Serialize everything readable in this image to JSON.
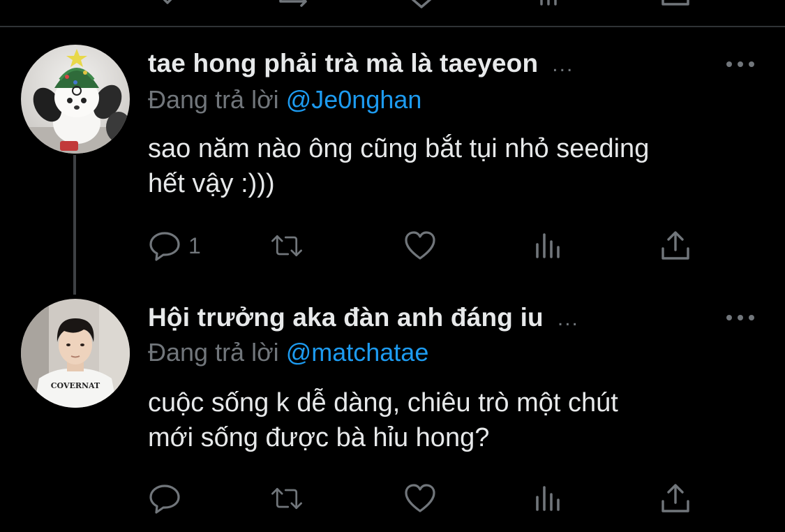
{
  "tweets": [
    {
      "display_name": "tae hong phải trà mà là taeyeon",
      "name_ellipsis": "...",
      "reply_prefix": "Đang trả lời",
      "reply_to": "@Je0nghan",
      "text_line1": "sao năm nào ông cũng bắt tụi nhỏ seeding",
      "text_line2": "hết vậy :)))",
      "reply_count": "1"
    },
    {
      "display_name": "Hội trưởng aka đàn anh đáng iu",
      "name_ellipsis": "...",
      "reply_prefix": "Đang trả lời",
      "reply_to": "@matchatae",
      "text_line1": "cuộc sống k dễ dàng, chiêu trò một chút",
      "text_line2": "mới sống được bà hỉu hong?",
      "reply_count": ""
    }
  ],
  "colors": {
    "background": "#000000",
    "text": "#e7e9ea",
    "secondary": "#71767b",
    "mention": "#1d9bf0",
    "divider": "#2f3336"
  },
  "icons": [
    "reply-icon",
    "retweet-icon",
    "like-icon",
    "views-icon",
    "share-icon",
    "more-icon"
  ]
}
